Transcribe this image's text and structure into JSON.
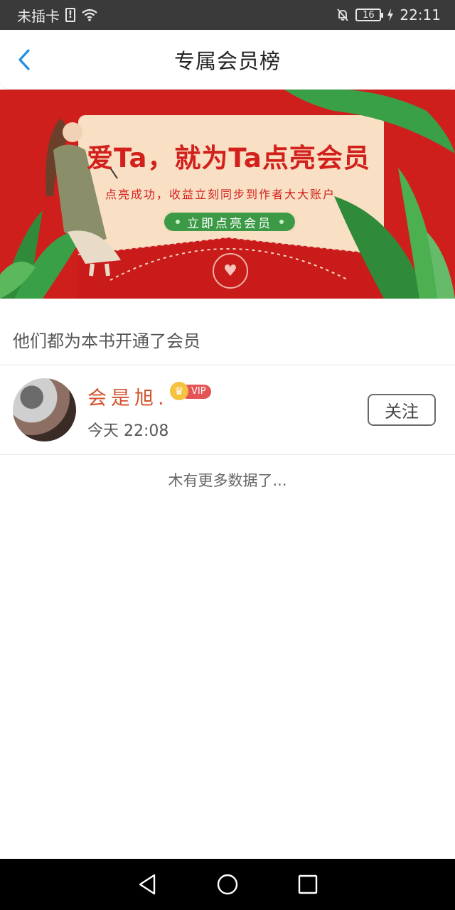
{
  "status_bar": {
    "carrier": "未插卡",
    "sim_alert": "!",
    "battery_level": "16",
    "time": "22:11"
  },
  "header": {
    "title": "专属会员榜"
  },
  "banner": {
    "headline": "爱Ta，就为Ta点亮会员",
    "subtitle": "点亮成功，收益立刻同步到作者大大账户",
    "cta_label": "立即点亮会员"
  },
  "section": {
    "label": "他们都为本书开通了会员"
  },
  "members": [
    {
      "name": "会是旭.",
      "vip_label": "VIP",
      "time": "今天 22:08",
      "follow_label": "关注"
    }
  ],
  "footer_text": "木有更多数据了...",
  "colors": {
    "accent_blue": "#1e8fe1",
    "banner_red": "#cf1f1d",
    "cta_green": "#3c9a46",
    "name_orange": "#d2522c",
    "vip_red": "#e45454"
  }
}
